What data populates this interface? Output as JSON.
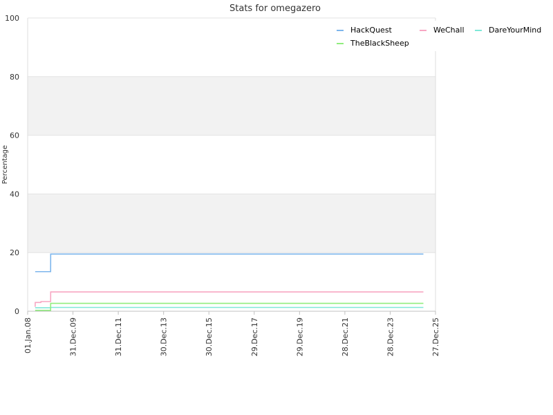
{
  "chart_data": {
    "type": "line",
    "title": "Stats for omegazero",
    "xlabel": "",
    "ylabel": "Percentage",
    "ylim": [
      0,
      100
    ],
    "xlim": [
      "2008-01-01",
      "2025-12-27"
    ],
    "yticks": [
      0,
      20,
      40,
      60,
      80,
      100
    ],
    "xticks": [
      {
        "date": "2008-01-01",
        "label": "01.Jan.08"
      },
      {
        "date": "2009-12-31",
        "label": "31.Dec.09"
      },
      {
        "date": "2011-12-31",
        "label": "31.Dec.11"
      },
      {
        "date": "2013-12-30",
        "label": "30.Dec.13"
      },
      {
        "date": "2015-12-30",
        "label": "30.Dec.15"
      },
      {
        "date": "2017-12-29",
        "label": "29.Dec.17"
      },
      {
        "date": "2019-12-29",
        "label": "29.Dec.19"
      },
      {
        "date": "2021-12-28",
        "label": "28.Dec.21"
      },
      {
        "date": "2023-12-28",
        "label": "28.Dec.23"
      },
      {
        "date": "2025-12-27",
        "label": "27.Dec.25"
      }
    ],
    "grid": true,
    "banded_background": true,
    "legend_position": "top-right",
    "series": [
      {
        "name": "HackQuest",
        "color": "#7cb5ec",
        "points": [
          [
            "2008-05-01",
            13.5
          ],
          [
            "2009-01-05",
            13.5
          ],
          [
            "2009-01-06",
            19.5
          ],
          [
            "2025-06-15",
            19.5
          ]
        ]
      },
      {
        "name": "WeChall",
        "color": "#f7a6c2",
        "points": [
          [
            "2008-05-01",
            1.5
          ],
          [
            "2008-05-02",
            3.0
          ],
          [
            "2008-08-01",
            3.0
          ],
          [
            "2008-08-02",
            3.3
          ],
          [
            "2009-01-05",
            3.3
          ],
          [
            "2009-01-06",
            6.6
          ],
          [
            "2025-06-15",
            6.6
          ]
        ]
      },
      {
        "name": "DareYourMind",
        "color": "#7ee8d8",
        "points": [
          [
            "2008-05-01",
            1.2
          ],
          [
            "2009-01-05",
            1.2
          ],
          [
            "2009-01-06",
            1.3
          ],
          [
            "2025-06-15",
            1.3
          ]
        ]
      },
      {
        "name": "TheBlackSheep",
        "color": "#90ed7d",
        "points": [
          [
            "2008-05-01",
            0.3
          ],
          [
            "2009-01-05",
            0.3
          ],
          [
            "2009-01-06",
            2.7
          ],
          [
            "2025-06-15",
            2.7
          ]
        ]
      }
    ]
  }
}
